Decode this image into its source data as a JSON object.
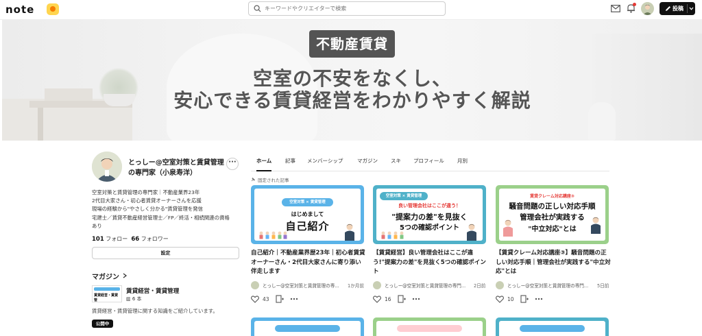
{
  "header": {
    "logo": "note",
    "search_placeholder": "キーワードやクリエイターで検索",
    "post_label": "投稿"
  },
  "banner": {
    "tag": "不動産賃貸",
    "line1": "空室の不安をなくし、",
    "line2": "安心できる賃貸経営をわかりやすく解説"
  },
  "profile": {
    "name": "とっしー@空室対策と賃貸管理の専門家（小泉寿洋）",
    "bio": [
      "空室対策と賃貸管理の専門家｜不動産業界23年",
      "2代目大家さん・初心者賃貸オーナーさんを応援",
      "現場の経験から\"やさしく分かる\"賃貸管理を発信",
      "宅建士／賃貸不動産経営管理士／FP／終活・相続関連の資格",
      "あり"
    ],
    "follow_count": "101",
    "follow_label": "フォロー",
    "follower_count": "66",
    "follower_label": "フォロワー",
    "settings_label": "設定"
  },
  "magazine": {
    "heading": "マガジン",
    "thumb_tag": "やさしくわかる",
    "thumb_text": "賃貸経営・賃貸管",
    "title": "賃貸経営・賃貸管理",
    "count": "6 本",
    "description": "賃貸経営・賃貸管理に関する知識をご紹介しています。",
    "badge": "公開中"
  },
  "tabs": [
    "ホーム",
    "記事",
    "メンバーシップ",
    "マガジン",
    "スキ",
    "プロフィール",
    "月別"
  ],
  "pinned_label": "固定された記事",
  "cards": [
    {
      "thumb_tag": "空室対策 × 賃貸管理",
      "thumb_sub": "はじめまして",
      "thumb_main": "自己紹介",
      "thumb_color": "#5ab3e8",
      "title": "自己紹介｜不動産業界歴23年｜初心者賃貸オーナーさん・2代目大家さんに寄り添い伴走します",
      "author": "とっしー@空室対策と賃貸管理の専...",
      "time": "1か月前",
      "likes": "43"
    },
    {
      "thumb_tag": "空室対策 × 賃貸管理",
      "thumb_sub": "良い管理会社はここが違う！",
      "thumb_main": "\"提案力の差\"を見抜く",
      "thumb_main2": "5つの確認ポイント",
      "thumb_color": "#4fb1c9",
      "title": "【賃貸経営】良い管理会社はここが違う!\"提案力の差\"を見抜く5つの確認ポイント",
      "author": "とっしー@空室対策と賃貸管理の専門...",
      "time": "2日前",
      "likes": "16"
    },
    {
      "thumb_tag": "賃貸クレーム対応講座③",
      "thumb_sub": "騒音問題の正しい対応手順",
      "thumb_main": "管理会社が実践する",
      "thumb_main2": "\"中立対応\"とは",
      "thumb_color": "#9bd08a",
      "title": "【賃貸クレーム対応講座③】騒音問題の正しい対応手順｜管理会社が実践する\"中立対応\"とは",
      "author": "とっしー@空室対策と賃貸管理の専門...",
      "time": "5日前",
      "likes": "10"
    }
  ]
}
